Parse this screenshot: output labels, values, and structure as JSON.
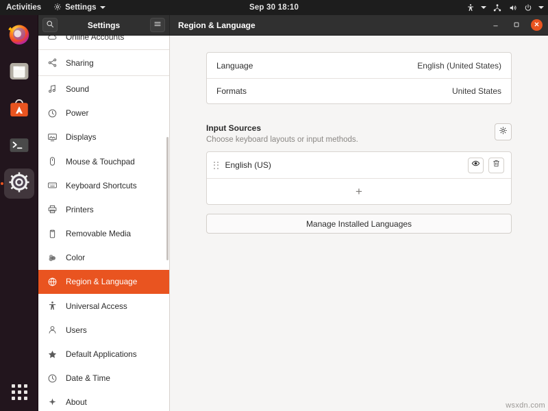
{
  "topbar": {
    "activities": "Activities",
    "app_menu": "Settings",
    "app_icon": "gear-icon",
    "clock": "Sep 30  18:10",
    "tray_icons": [
      "accessibility-icon",
      "chevron-down-icon",
      "network-icon",
      "volume-icon",
      "power-icon",
      "chevron-down-icon"
    ]
  },
  "dock": {
    "items": [
      {
        "name": "firefox",
        "icon": "firefox-icon",
        "active": false
      },
      {
        "name": "files",
        "icon": "files-folder-icon",
        "active": false
      },
      {
        "name": "ubuntu-software",
        "icon": "ubuntu-software-icon",
        "active": false
      },
      {
        "name": "terminal",
        "icon": "terminal-icon",
        "active": false
      },
      {
        "name": "settings",
        "icon": "gear-icon",
        "active": true
      }
    ],
    "show_applications": "show-applications-icon"
  },
  "window": {
    "left_title": "Settings",
    "right_title": "Region & Language",
    "search_icon": "search-icon",
    "menu_icon": "hamburger-menu-icon",
    "minimize": "minimize-icon",
    "maximize": "maximize-icon",
    "close": "close-icon"
  },
  "sidebar": {
    "items": [
      {
        "label": "Online Accounts",
        "icon": "cloud-icon",
        "selected": false
      },
      {
        "label": "Sharing",
        "icon": "share-nodes-icon",
        "selected": false
      },
      {
        "label": "Sound",
        "icon": "music-note-icon",
        "selected": false
      },
      {
        "label": "Power",
        "icon": "power-clock-icon",
        "selected": false
      },
      {
        "label": "Displays",
        "icon": "display-icon",
        "selected": false
      },
      {
        "label": "Mouse & Touchpad",
        "icon": "mouse-icon",
        "selected": false
      },
      {
        "label": "Keyboard Shortcuts",
        "icon": "keyboard-icon",
        "selected": false
      },
      {
        "label": "Printers",
        "icon": "printer-icon",
        "selected": false
      },
      {
        "label": "Removable Media",
        "icon": "removable-media-icon",
        "selected": false
      },
      {
        "label": "Color",
        "icon": "color-icon",
        "selected": false
      },
      {
        "label": "Region & Language",
        "icon": "globe-icon",
        "selected": true
      },
      {
        "label": "Universal Access",
        "icon": "accessibility-icon",
        "selected": false
      },
      {
        "label": "Users",
        "icon": "user-icon",
        "selected": false
      },
      {
        "label": "Default Applications",
        "icon": "star-icon",
        "selected": false
      },
      {
        "label": "Date & Time",
        "icon": "clock-icon",
        "selected": false
      },
      {
        "label": "About",
        "icon": "info-sparkle-icon",
        "selected": false
      }
    ]
  },
  "main": {
    "language_row": {
      "label": "Language",
      "value": "English (United States)"
    },
    "formats_row": {
      "label": "Formats",
      "value": "United States"
    },
    "input_sources": {
      "title": "Input Sources",
      "subtitle": "Choose keyboard layouts or input methods.",
      "options_icon": "gear-icon",
      "sources": [
        {
          "name": "English (US)",
          "drag_icon": "drag-handle-icon",
          "preview_icon": "eye-icon",
          "remove_icon": "trash-icon"
        }
      ],
      "add_label": "+"
    },
    "manage_button": "Manage Installed Languages"
  },
  "watermark": "wsxdn.com",
  "colors": {
    "accent": "#e95420",
    "topbar_bg": "#1d1d1d",
    "titlebar_bg": "#303030",
    "content_bg": "#f6f5f4"
  }
}
